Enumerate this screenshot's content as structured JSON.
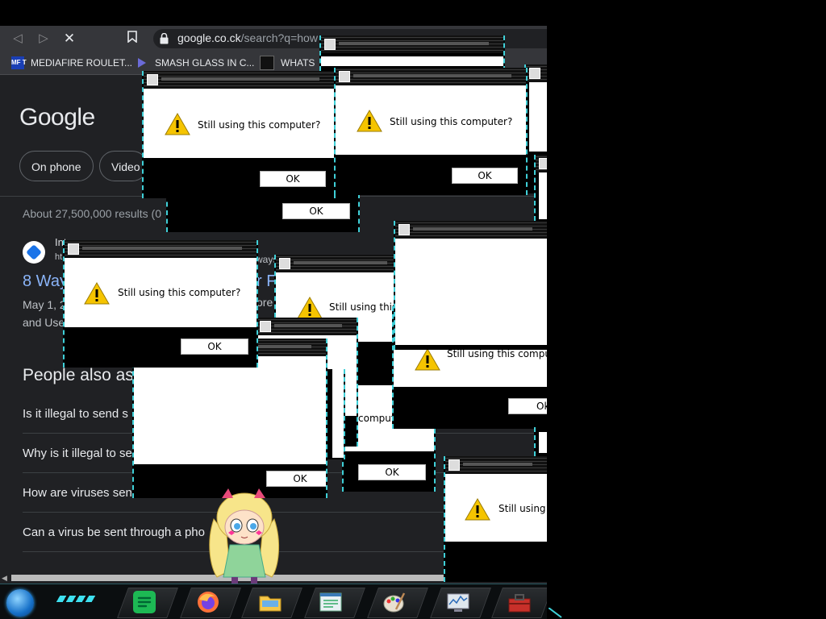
{
  "browser": {
    "url_host": "google.co.ck",
    "url_path": "/search?q=how",
    "bookmarks": [
      {
        "label": "MEDIAFIRE ROULET...",
        "icon": "mediafire-icon",
        "badge": "MF T"
      },
      {
        "label": "SMASH GLASS IN C...",
        "icon": "bookmark-site-icon",
        "badge": ""
      },
      {
        "label": "WHATS",
        "icon": "bookmark-site-icon",
        "badge": ""
      }
    ]
  },
  "google": {
    "logo": "Google",
    "chips": [
      "On phone",
      "Video"
    ],
    "stats": "About 27,500,000 results (0",
    "result": {
      "site_name": "Int",
      "site_url": "ht",
      "title": "8 Way",
      "title_tail": "r F",
      "snippet_line1": "May 1, 2",
      "snippet_tail": "ore",
      "snippet_line2": "and Use",
      "url_tail": "ways"
    },
    "paa_heading": "People also as",
    "paa": [
      "Is it illegal to send s",
      "Why is it illegal to se",
      "How are viruses sent?",
      "Can a virus be sent through a pho"
    ]
  },
  "dialogs": {
    "message": "Still using this computer?",
    "partial_message_1": "Still using this",
    "partial_message_2": "Still using this compute",
    "partial_message_3": "Still using th",
    "partial_message_4": "comput",
    "ok": "OK",
    "ok_partial": "Ok"
  },
  "taskbar": {
    "apps": [
      "spotify-icon",
      "firefox-icon",
      "file-explorer-icon",
      "notepad-icon",
      "paint-icon",
      "performance-monitor-icon",
      "toolbox-icon"
    ]
  },
  "colors": {
    "accent": "#3fd0d8",
    "link": "#8ab4f8",
    "page_bg": "#202124"
  }
}
